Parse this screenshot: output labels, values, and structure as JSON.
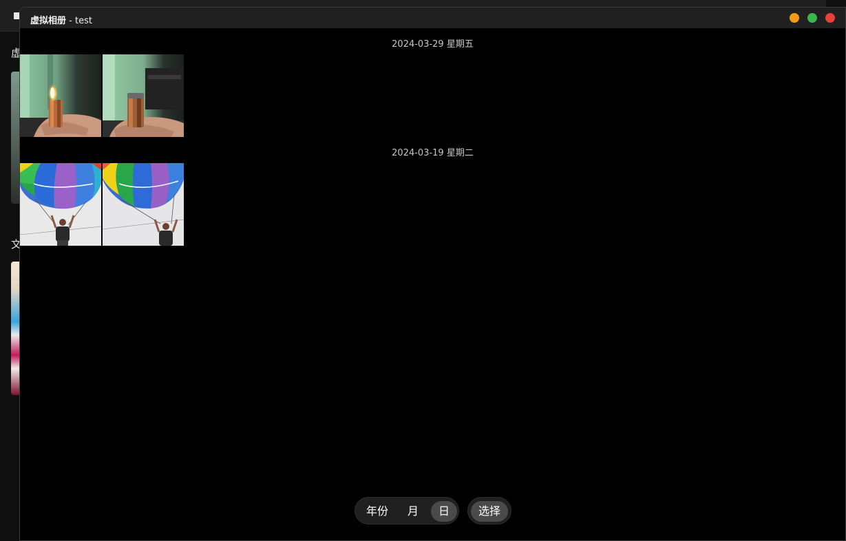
{
  "background_window": {
    "heading_1": "虚",
    "heading_2": "文"
  },
  "window": {
    "app_name": "虚拟相册",
    "title_separator": " - ",
    "album_name": "test",
    "controls": [
      "minimize",
      "maximize",
      "close"
    ],
    "control_colors": {
      "minimize": "#f39c12",
      "maximize": "#3cb54a",
      "close": "#e8413a"
    }
  },
  "groups": [
    {
      "date": "2024-03-29 星期五",
      "photos": [
        "lighter-lit",
        "lighter-unlit"
      ]
    },
    {
      "date": "2024-03-19 星期二",
      "photos": [
        "parasail-1",
        "parasail-2"
      ]
    }
  ],
  "view_modes": {
    "year": "年份",
    "month": "月",
    "day": "日",
    "selected": "日"
  },
  "select_button": "选择"
}
